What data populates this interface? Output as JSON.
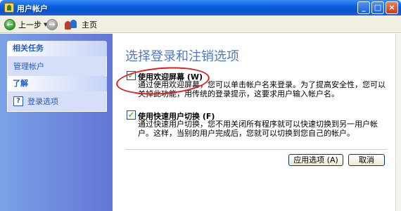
{
  "window": {
    "title": "用户帐户",
    "minimize_label": "_",
    "maximize_label": "□",
    "close_label": "×"
  },
  "toolbar": {
    "back_label": "上一步",
    "forward_label": "",
    "home_label": "主页"
  },
  "sidebar": {
    "related_tasks": {
      "header": "相关任务",
      "items": [
        {
          "label": "管理帐户"
        }
      ]
    },
    "learn_about": {
      "header": "了解",
      "items": [
        {
          "label": "登录选项",
          "icon": "help-icon"
        }
      ]
    }
  },
  "main": {
    "title": "选择登录和注销选项",
    "options": [
      {
        "checked": true,
        "label": "使用欢迎屏幕 (W)",
        "description": "通过使用欢迎屏幕，您可以单击帐户名来登录。为了提高安全性，您可以关掉此功能，用传统的登录提示，这要求用户输入帐户名。"
      },
      {
        "checked": true,
        "label": "使用快速用户切换 (F)",
        "description": "通过快速用户切换，您不用关闭所有程序就可以快速切换到另一用户帐户。这样，当别的用户完成后，您就可以切换到您自己的帐户。"
      }
    ],
    "apply_button": "应用选项 (A)",
    "cancel_button": "取消"
  },
  "colors": {
    "titlebar": "#0b5fe0",
    "taskpane": "#6375d6",
    "heading": "#4e78c9",
    "annotation": "#e21c1c"
  }
}
